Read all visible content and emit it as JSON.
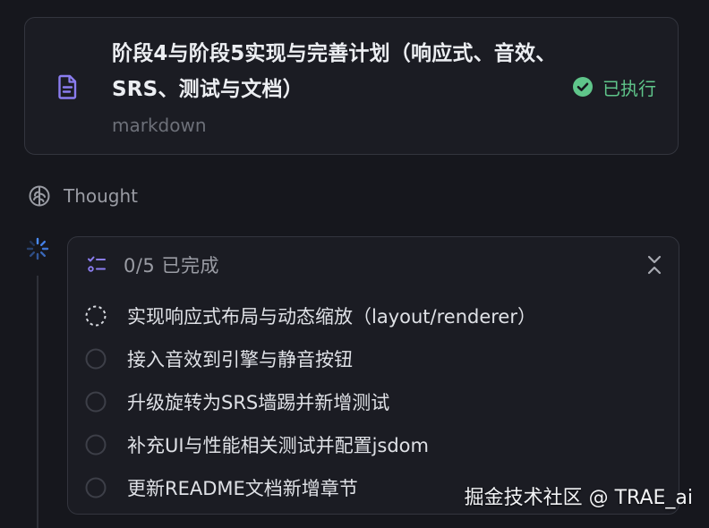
{
  "plan": {
    "title": "阶段4与阶段5实现与完善计划（响应式、音效、SRS、测试与文档）",
    "subtitle": "markdown",
    "icon": "document-icon",
    "status": {
      "label": "已执行",
      "icon": "check-circle-icon",
      "color": "#5fc58a"
    }
  },
  "thought": {
    "label": "Thought",
    "icon": "brain-icon"
  },
  "todos": {
    "progress": "0/5 已完成",
    "items": [
      {
        "text": "实现响应式布局与动态缩放（layout/renderer）",
        "state": "in-progress"
      },
      {
        "text": "接入音效到引擎与静音按钮",
        "state": "pending"
      },
      {
        "text": "升级旋转为SRS墙踢并新增测试",
        "state": "pending"
      },
      {
        "text": "补充UI与性能相关测试并配置jsdom",
        "state": "pending"
      },
      {
        "text": "更新README文档新增章节",
        "state": "pending"
      }
    ]
  },
  "watermark": "掘金技术社区 @ TRAE_ai",
  "colors": {
    "background": "#16171d",
    "card": "#1b1c23",
    "border": "#33353e",
    "accent": "#8b7df0",
    "spinner": "#4a8cff",
    "success": "#5fc58a"
  }
}
